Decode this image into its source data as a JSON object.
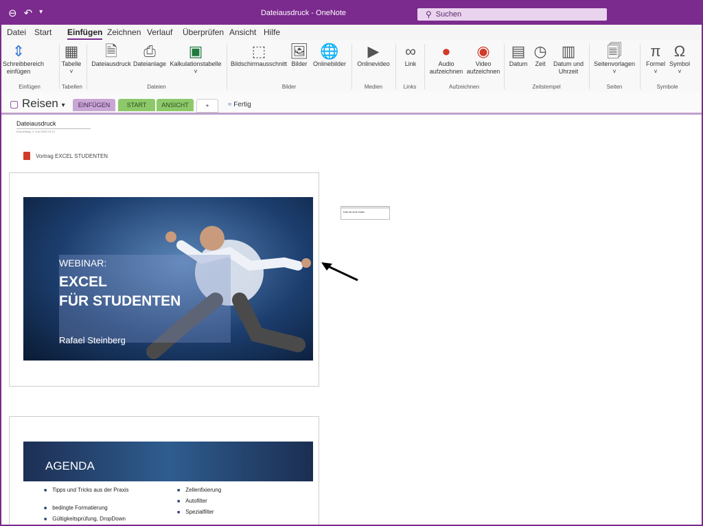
{
  "window": {
    "title": "Dateiausdruck - OneNote"
  },
  "search": {
    "placeholder": "Suchen"
  },
  "menu": {
    "items": [
      "Datei",
      "Start",
      "Einfügen",
      "Zeichnen",
      "Verlauf",
      "Überprüfen",
      "Ansicht",
      "Hilfe"
    ],
    "active": "Einfügen"
  },
  "ribbon": {
    "buttons": [
      {
        "label1": "Schreibbereich",
        "label2": "einfügen"
      },
      {
        "label1": "Tabelle",
        "label2": "˅"
      },
      {
        "label1": "Dateiausdruck",
        "label2": ""
      },
      {
        "label1": "Dateianlage",
        "label2": ""
      },
      {
        "label1": "Kalkulationstabelle",
        "label2": "˅"
      },
      {
        "label1": "Bildschirmausschnitt",
        "label2": ""
      },
      {
        "label1": "Bilder",
        "label2": ""
      },
      {
        "label1": "Onlinebilder",
        "label2": ""
      },
      {
        "label1": "Onlinevideo",
        "label2": ""
      },
      {
        "label1": "Link",
        "label2": ""
      },
      {
        "label1": "Audio",
        "label2": "aufzeichnen"
      },
      {
        "label1": "Video",
        "label2": "aufzeichnen"
      },
      {
        "label1": "Datum",
        "label2": ""
      },
      {
        "label1": "Zeit",
        "label2": ""
      },
      {
        "label1": "Datum und",
        "label2": "Uhrzeit"
      },
      {
        "label1": "Seitenvorlagen",
        "label2": "˅"
      },
      {
        "label1": "Formel",
        "label2": "˅"
      },
      {
        "label1": "Symbol",
        "label2": "˅"
      }
    ],
    "groups": [
      "Einfügen",
      "Tabellen",
      "Dateien",
      "Bilder",
      "Medien",
      "Links",
      "Aufzeichnen",
      "Zeitstempel",
      "Seiten",
      "Symbole"
    ]
  },
  "notebook": {
    "name": "Reisen"
  },
  "sections": [
    {
      "label": "EINFÜGEN",
      "color": "#c9a7d4"
    },
    {
      "label": "START",
      "color": "#8dc96a"
    },
    {
      "label": "ANSICHT",
      "color": "#8dc96a"
    },
    {
      "label": "+",
      "color": "#ffffff"
    }
  ],
  "fertig": "Fertig",
  "page": {
    "title": "Dateiausdruck",
    "date": "Donnerstag, 4. Juni 2020      13:14",
    "attachment": "Vortrag EXCEL STUDENTEN",
    "note": "Das ist eine Notiz"
  },
  "slide1": {
    "webinar": "WEBINAR:",
    "line1": "EXCEL",
    "line2": "FÜR STUDENTEN",
    "author": "Rafael Steinberg"
  },
  "slide2": {
    "title": "AGENDA",
    "left": [
      "Tipps und Tricks aus der Praxis",
      "bedingte Formatierung",
      "Gültigkeitsprüfung, DropDown"
    ],
    "right": [
      "Zellenfixierung",
      "Autofilter",
      "Spezialfilter"
    ]
  },
  "colors": {
    "accent": "#7b2a8e"
  }
}
